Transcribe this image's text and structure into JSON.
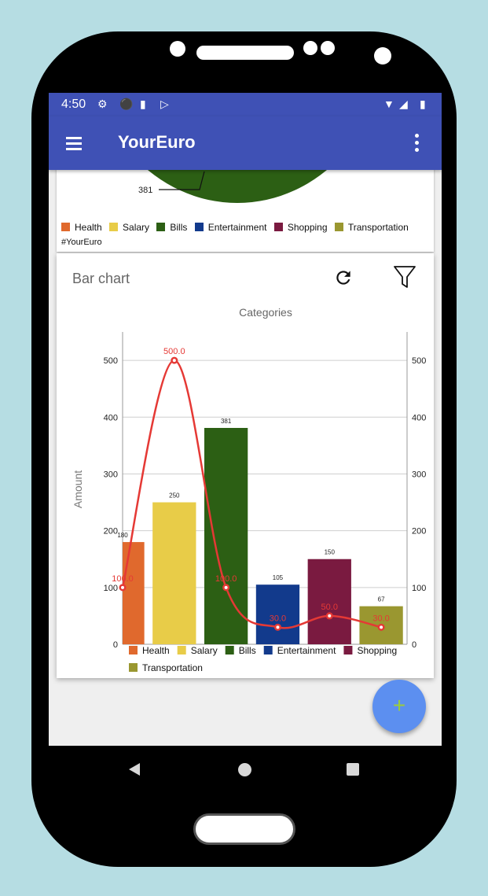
{
  "status_bar": {
    "time": "4:50",
    "icons": [
      "settings-icon",
      "shield-icon",
      "sd-card-icon",
      "play-store-icon",
      "wifi-icon",
      "signal-icon",
      "battery-icon"
    ]
  },
  "app_bar": {
    "title": "YourEuro",
    "menu_icon": "hamburger-menu-icon",
    "overflow_icon": "more-vert-icon"
  },
  "pie_card": {
    "visible_slice_label": "381",
    "legend": [
      {
        "label": "Health",
        "color": "#e0692d"
      },
      {
        "label": "Salary",
        "color": "#e8cc48"
      },
      {
        "label": "Bills",
        "color": "#2c5f14"
      },
      {
        "label": "Entertainment",
        "color": "#123a8c"
      },
      {
        "label": "Shopping",
        "color": "#7a1a40"
      },
      {
        "label": "Transportation",
        "color": "#9a9730"
      }
    ],
    "hashtag": "#YourEuro"
  },
  "bar_card": {
    "title": "Bar chart",
    "refresh_icon": "refresh-icon",
    "filter_icon": "filter-icon"
  },
  "chart_data": {
    "type": "bar",
    "title": "Categories",
    "ylabel": "Amount",
    "xlabel": "",
    "ylim": [
      0,
      550
    ],
    "yticks": [
      0,
      100,
      200,
      300,
      400,
      500
    ],
    "grid": true,
    "legend_position": "bottom",
    "categories": [
      "Health",
      "Salary",
      "Bills",
      "Entertainment",
      "Shopping",
      "Transportation"
    ],
    "bar_values": [
      180,
      250,
      381,
      105,
      150,
      67
    ],
    "bar_labels": [
      "180",
      "250",
      "381",
      "105",
      "150",
      "67"
    ],
    "colors": [
      "#e0692d",
      "#e8cc48",
      "#2c5f14",
      "#123a8c",
      "#7a1a40",
      "#9a9730"
    ],
    "line": {
      "color": "#e53935",
      "values": [
        100.0,
        500.0,
        100.0,
        30.0,
        50.0,
        30.0
      ],
      "labels": [
        "100.0",
        "500.0",
        "100.0",
        "30.0",
        "50.0",
        "30.0"
      ]
    }
  },
  "fab": {
    "label": "+"
  },
  "nav_bar": {
    "back_icon": "back-icon",
    "home_icon": "home-icon",
    "recents_icon": "recents-icon"
  }
}
